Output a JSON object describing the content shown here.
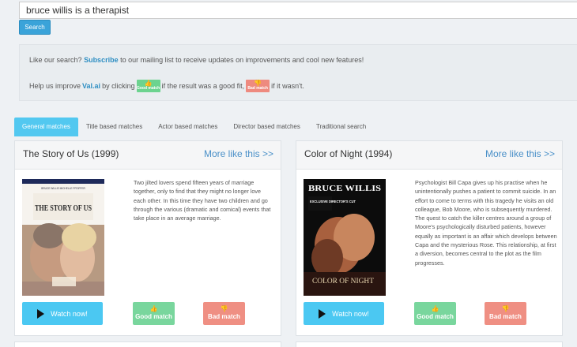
{
  "search": {
    "query": "bruce willis is a therapist",
    "button_label": "Search"
  },
  "info": {
    "line1_before": "Like our search?",
    "line1_link": "Subscribe",
    "line1_after": "to our mailing list to receive updates on improvements and cool new features!",
    "line2_before": "Help us improve",
    "line2_brand": "Val.ai",
    "line2_mid1": "by clicking",
    "good_label": "Good match",
    "line2_mid2": "if the result was a good fit,",
    "bad_label": "Bad match",
    "line2_after": "if it wasn't."
  },
  "tabs": [
    "General matches",
    "Title based matches",
    "Actor based matches",
    "Director based matches",
    "Traditional search"
  ],
  "results": [
    {
      "title": "The Story of Us (1999)",
      "more_label": "More like this >>",
      "poster_top_text": "BRUCE WILLIS   MICHELLE PFEIFFER",
      "poster_title": "THE STORY OF US",
      "description": "Two jilted lovers spend fifteen years of marriage together, only to find that they might no longer love each other. In this time they have two children and go through the various (dramatic and comical) events that take place in an average marriage.",
      "watch_label": "Watch now!",
      "good_label": "Good match",
      "bad_label": "Bad match"
    },
    {
      "title": "Color of Night (1994)",
      "more_label": "More like this >>",
      "poster_top_text": "BRUCE WILLIS",
      "poster_badge": "EXCLUSIVE DIRECTOR'S CUT",
      "poster_title": "COLOR OF NIGHT",
      "description": "Psychologist Bill Capa gives up his practise when he unintentionally pushes a patient to commit suicide. In an effort to come to terms with this tragedy he visits an old colleague, Bob Moore, who is subsequently murdered. The quest to catch the killer centres around a group of Moore's psychologically disturbed patients, however equally as important is an affair which develops between Capa and the mysterious Rose. This relationship, at first a diversion, becomes central to the plot as the film progresses.",
      "watch_label": "Watch now!",
      "good_label": "Good match",
      "bad_label": "Bad match"
    }
  ],
  "colors": {
    "accent": "#52c8f0",
    "good": "#79d69d",
    "bad": "#ef8f83",
    "link": "#4a90c8"
  }
}
